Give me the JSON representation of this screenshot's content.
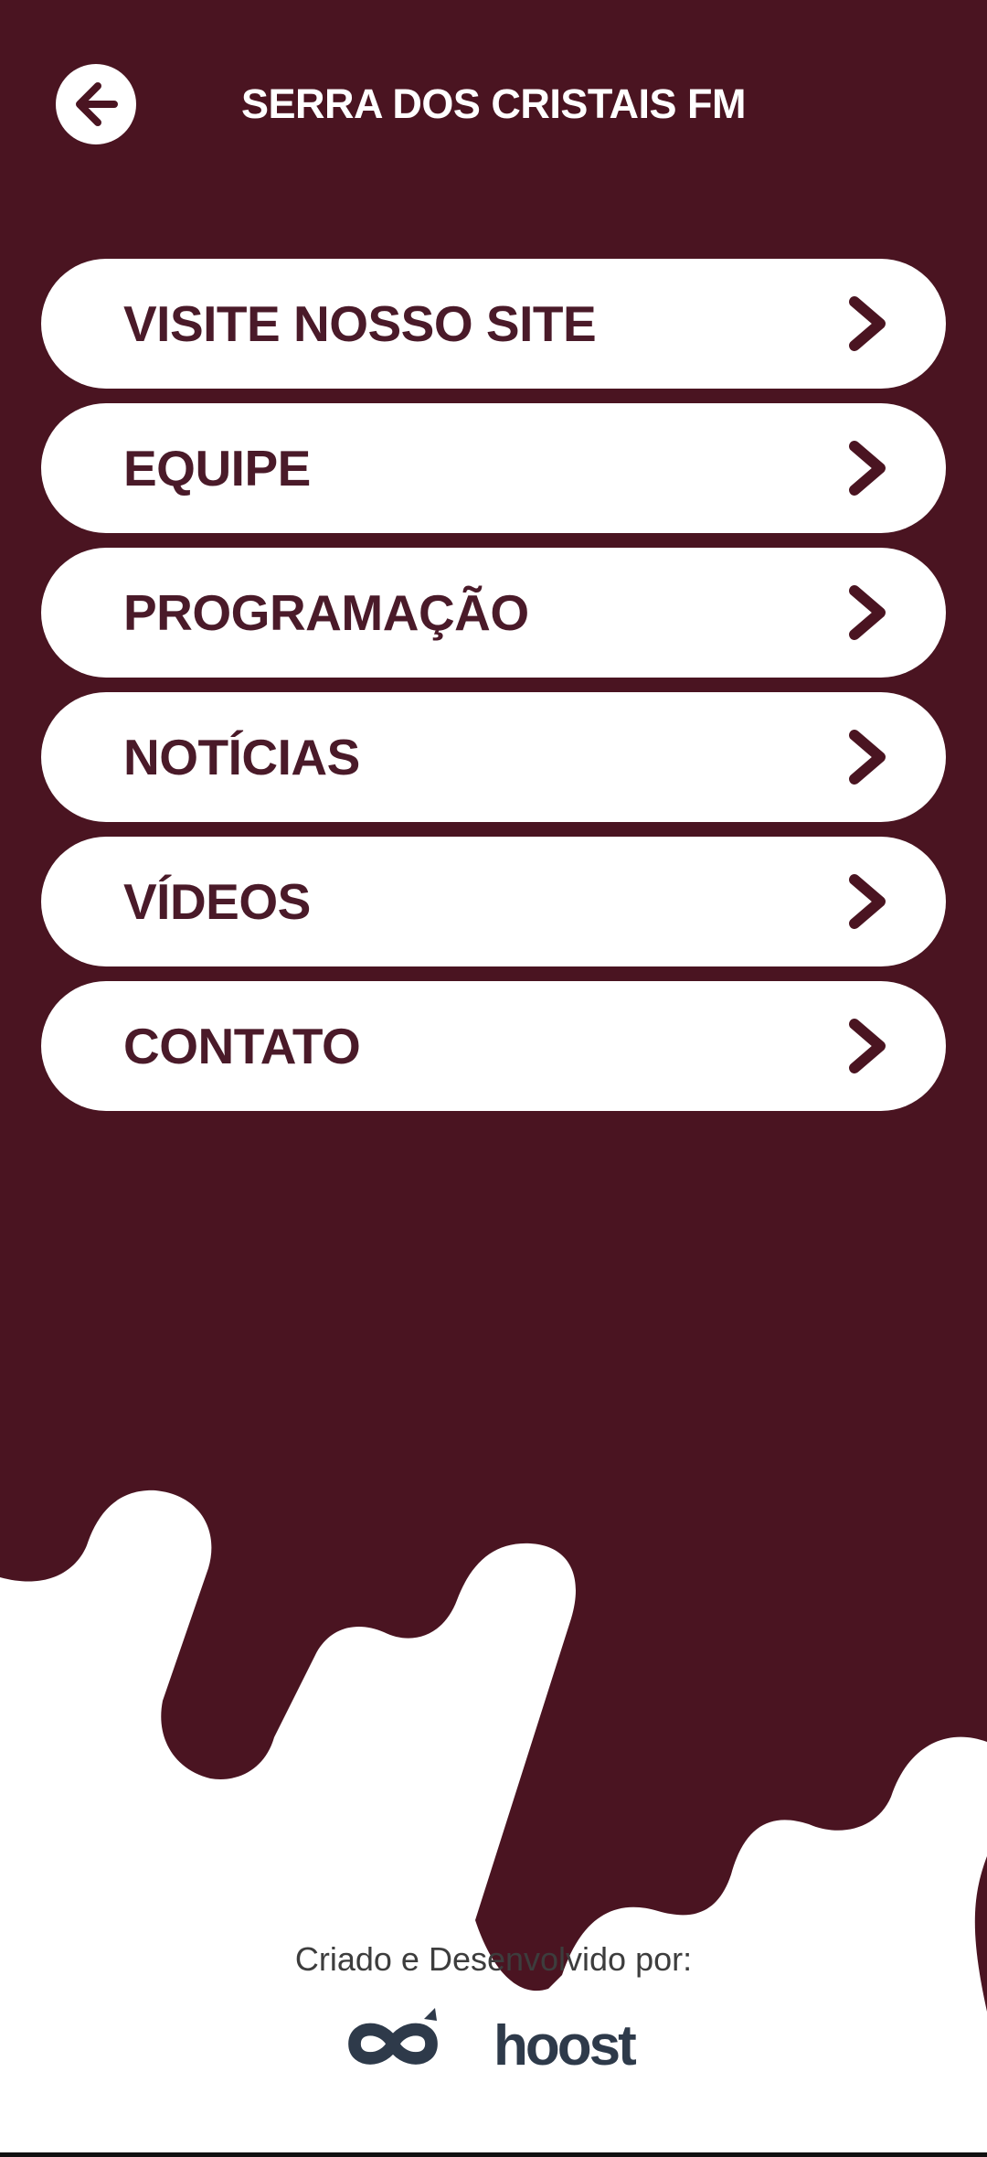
{
  "header": {
    "title": "SERRA DOS CRISTAIS FM",
    "back_icon": "arrow-left-icon"
  },
  "menu": {
    "items": [
      {
        "label": "VISITE NOSSO SITE",
        "icon": "chevron-right-icon"
      },
      {
        "label": "EQUIPE",
        "icon": "chevron-right-icon"
      },
      {
        "label": "PROGRAMAÇÃO",
        "icon": "chevron-right-icon"
      },
      {
        "label": "NOTÍCIAS",
        "icon": "chevron-right-icon"
      },
      {
        "label": "VÍDEOS",
        "icon": "chevron-right-icon"
      },
      {
        "label": "CONTATO",
        "icon": "chevron-right-icon"
      }
    ]
  },
  "footer": {
    "credit_text": "Criado e Desenvolvido por:",
    "brand": "hoost"
  },
  "colors": {
    "primary": "#4a1421",
    "menu_text": "#4a1a29",
    "logo": "#2e3a4a"
  }
}
